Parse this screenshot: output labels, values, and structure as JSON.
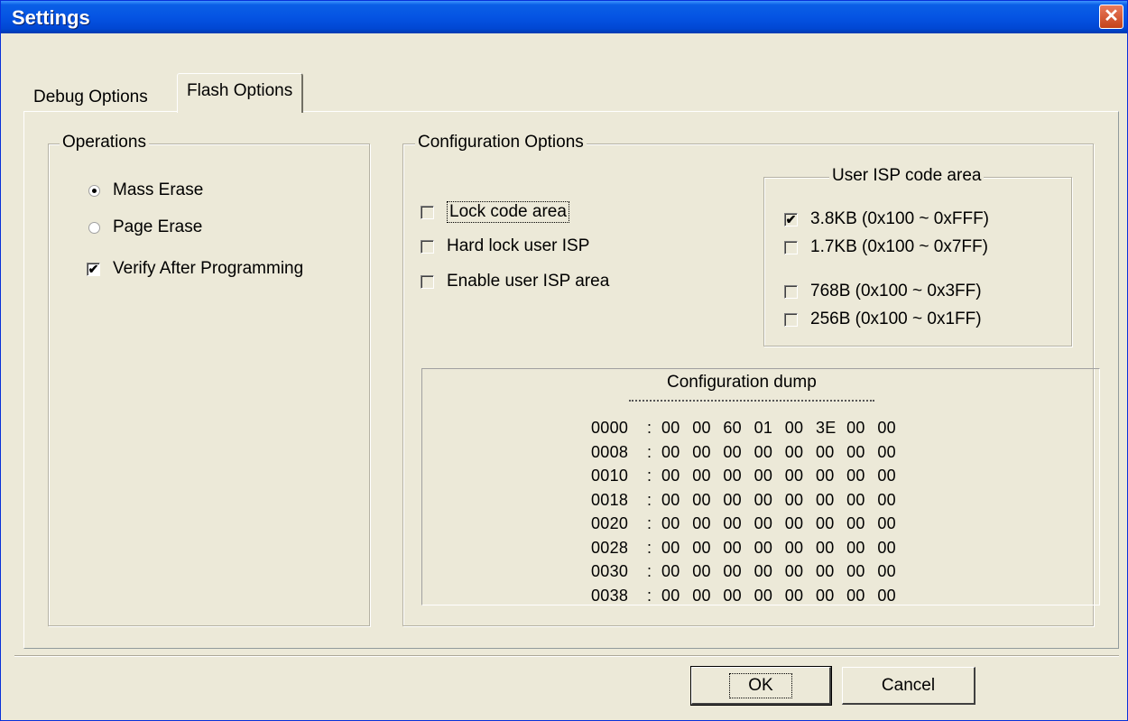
{
  "window": {
    "title": "Settings",
    "close_glyph": "✕"
  },
  "tabs": [
    {
      "label": "Debug Options",
      "selected": false
    },
    {
      "label": "Flash Options",
      "selected": true
    }
  ],
  "operations": {
    "label": "Operations",
    "mass_erase": {
      "label": "Mass Erase",
      "selected": true
    },
    "page_erase": {
      "label": "Page Erase",
      "selected": false
    },
    "verify": {
      "label": "Verify After Programming",
      "checked": true
    }
  },
  "config": {
    "label": "Configuration Options",
    "lock_code": {
      "label": "Lock code area",
      "checked": false
    },
    "hard_lock": {
      "label": "Hard lock user ISP",
      "checked": false
    },
    "enable_isp": {
      "label": "Enable user ISP area",
      "checked": false
    }
  },
  "isp_area": {
    "label": "User ISP code area",
    "options": [
      {
        "label": "3.8KB (0x100 ~ 0xFFF)",
        "checked": true
      },
      {
        "label": "1.7KB (0x100 ~ 0x7FF)",
        "checked": false
      },
      {
        "label": "768B (0x100 ~ 0x3FF)",
        "checked": false
      },
      {
        "label": "256B (0x100 ~ 0x1FF)",
        "checked": false
      }
    ]
  },
  "dump": {
    "title": "Configuration dump",
    "rows": [
      {
        "addr": "0000",
        "bytes": [
          "00",
          "00",
          "60",
          "01",
          "00",
          "3E",
          "00",
          "00"
        ]
      },
      {
        "addr": "0008",
        "bytes": [
          "00",
          "00",
          "00",
          "00",
          "00",
          "00",
          "00",
          "00"
        ]
      },
      {
        "addr": "0010",
        "bytes": [
          "00",
          "00",
          "00",
          "00",
          "00",
          "00",
          "00",
          "00"
        ]
      },
      {
        "addr": "0018",
        "bytes": [
          "00",
          "00",
          "00",
          "00",
          "00",
          "00",
          "00",
          "00"
        ]
      },
      {
        "addr": "0020",
        "bytes": [
          "00",
          "00",
          "00",
          "00",
          "00",
          "00",
          "00",
          "00"
        ]
      },
      {
        "addr": "0028",
        "bytes": [
          "00",
          "00",
          "00",
          "00",
          "00",
          "00",
          "00",
          "00"
        ]
      },
      {
        "addr": "0030",
        "bytes": [
          "00",
          "00",
          "00",
          "00",
          "00",
          "00",
          "00",
          "00"
        ]
      },
      {
        "addr": "0038",
        "bytes": [
          "00",
          "00",
          "00",
          "00",
          "00",
          "00",
          "00",
          "00"
        ]
      }
    ]
  },
  "buttons": {
    "ok": "OK",
    "cancel": "Cancel"
  },
  "check_glyph": "✔"
}
